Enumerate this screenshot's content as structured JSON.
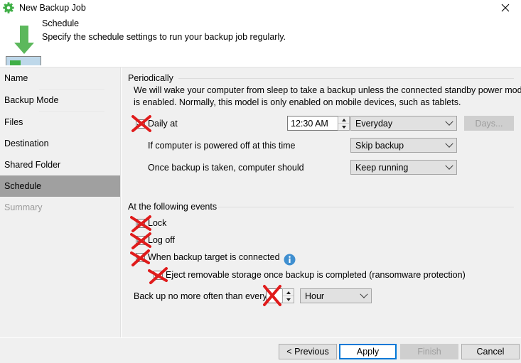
{
  "window": {
    "title": "New Backup Job",
    "app_icon": "gear-icon",
    "close_label": "×"
  },
  "header": {
    "icon": "download-arrow-drive-icon",
    "title": "Schedule",
    "subtitle": "Specify the schedule settings to run your backup job regularly."
  },
  "sidebar": {
    "items": [
      {
        "label": "Name",
        "state": "normal"
      },
      {
        "label": "Backup Mode",
        "state": "normal"
      },
      {
        "label": "Files",
        "state": "normal"
      },
      {
        "label": "Destination",
        "state": "normal"
      },
      {
        "label": "Shared Folder",
        "state": "normal"
      },
      {
        "label": "Schedule",
        "state": "selected"
      },
      {
        "label": "Summary",
        "state": "disabled"
      }
    ]
  },
  "periodically": {
    "group_label": "Periodically",
    "description_line1": "We will wake your computer from sleep to take a backup unless the connected standby power model",
    "description_line2": "is enabled. Normally, this model is only enabled on mobile devices, such as tablets.",
    "daily_at_label": "Daily at",
    "daily_at_checked": true,
    "time_value": "12:30 AM",
    "frequency_value": "Everyday",
    "days_button_label": "Days...",
    "days_button_disabled": true,
    "powered_off_label": "If computer is powered off at this time",
    "powered_off_value": "Skip backup",
    "after_backup_label": "Once backup is taken, computer should",
    "after_backup_value": "Keep running"
  },
  "events": {
    "group_label": "At the following events",
    "items": [
      {
        "label": "Lock",
        "checked": true,
        "indent": 0
      },
      {
        "label": "Log off",
        "checked": true,
        "indent": 0
      },
      {
        "label": "When backup target is connected",
        "checked": true,
        "indent": 0,
        "info": "info-icon"
      },
      {
        "label": "Eject removable storage once backup is completed (ransomware protection)",
        "checked": true,
        "indent": 1
      }
    ],
    "throttle_label": "Back up no more often than every",
    "throttle_value": "",
    "throttle_unit": "Hour"
  },
  "footer": {
    "previous_label": "< Previous",
    "apply_label": "Apply",
    "finish_label": "Finish",
    "finish_disabled": true,
    "cancel_label": "Cancel"
  },
  "colors": {
    "dialog_bg": "#f0f0f0",
    "title_bg": "#ffffff",
    "accent": "#0078d7",
    "selected_item": "#a0a0a0",
    "brand_green": "#5cb85c",
    "annotation_red": "#e01b1b",
    "info_blue": "#3f8fd0"
  }
}
